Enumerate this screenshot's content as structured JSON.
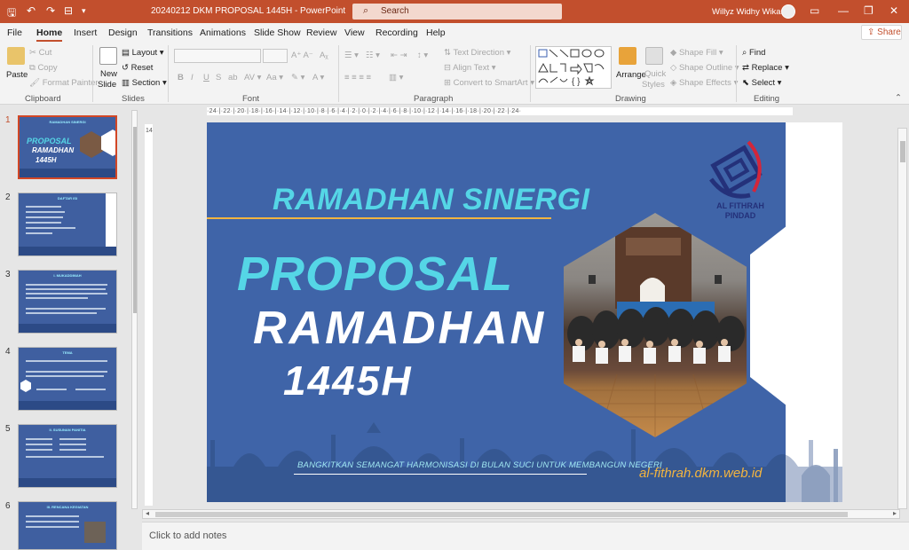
{
  "titlebar": {
    "doc_title": "20240212 DKM PROPOSAL 1445H  -  PowerPoint",
    "search_placeholder": "Search",
    "user_name": "Willyz Widhy Wikarya"
  },
  "menu": {
    "tabs": [
      "File",
      "Home",
      "Insert",
      "Design",
      "Transitions",
      "Animations",
      "Slide Show",
      "Review",
      "View",
      "Recording",
      "Help"
    ],
    "share": "Share"
  },
  "ribbon": {
    "clipboard": {
      "paste": "Paste",
      "cut": "Cut",
      "copy": "Copy",
      "format_painter": "Format Painter",
      "label": "Clipboard"
    },
    "slides": {
      "new_slide": "New",
      "new_slide2": "Slide",
      "layout": "Layout",
      "reset": "Reset",
      "section": "Section",
      "label": "Slides"
    },
    "font": {
      "label": "Font"
    },
    "paragraph": {
      "text_direction": "Text Direction",
      "align_text": "Align Text",
      "smartart": "Convert to SmartArt",
      "label": "Paragraph"
    },
    "drawing": {
      "arrange": "Arrange",
      "quick_styles": "Quick",
      "quick_styles2": "Styles",
      "shape_fill": "Shape Fill",
      "shape_outline": "Shape Outline",
      "shape_effects": "Shape Effects",
      "label": "Drawing"
    },
    "editing": {
      "find": "Find",
      "replace": "Replace",
      "select": "Select",
      "label": "Editing"
    }
  },
  "thumbnails": [
    {
      "num": "1",
      "title": "RAMADHAN SINERGI"
    },
    {
      "num": "2",
      "title": "DAFTAR ISI"
    },
    {
      "num": "3",
      "title": "I. MUKADDIMAH"
    },
    {
      "num": "4",
      "title": "TEMA"
    },
    {
      "num": "5",
      "title": "II. SUSUNAN PANITIA"
    },
    {
      "num": "6",
      "title": "III. RENCANA KEGIATAN"
    }
  ],
  "ruler": {
    "h": "·24·|·22·|·20·|·18·|·16·|·14·|·12·|·10·|·8·|·6·|·4·|·2·|·0·|·2·|·4·|·6·|·8·|·10·|·12·|·14·|·16·|·18·|·20·|·22·|·24·",
    "v": "14"
  },
  "slide": {
    "title1": "RAMADHAN SINERGI",
    "title2": "PROPOSAL",
    "title3": "RAMADHAN",
    "title4": "1445H",
    "tagline": "BANGKITKAN SEMANGAT HARMONISASI DI BULAN SUCI UNTUK MEMBANGUN NEGERI",
    "website": "al-fithrah.dkm.web.id",
    "logo_line1": "AL FITHRAH",
    "logo_line2": "PINDAD"
  },
  "notes": {
    "placeholder": "Click to add notes"
  },
  "colors": {
    "accent": "#c24f2d",
    "slide_bg": "#3f64a8",
    "title_cyan": "#55d6e6",
    "gold": "#f2b440"
  }
}
